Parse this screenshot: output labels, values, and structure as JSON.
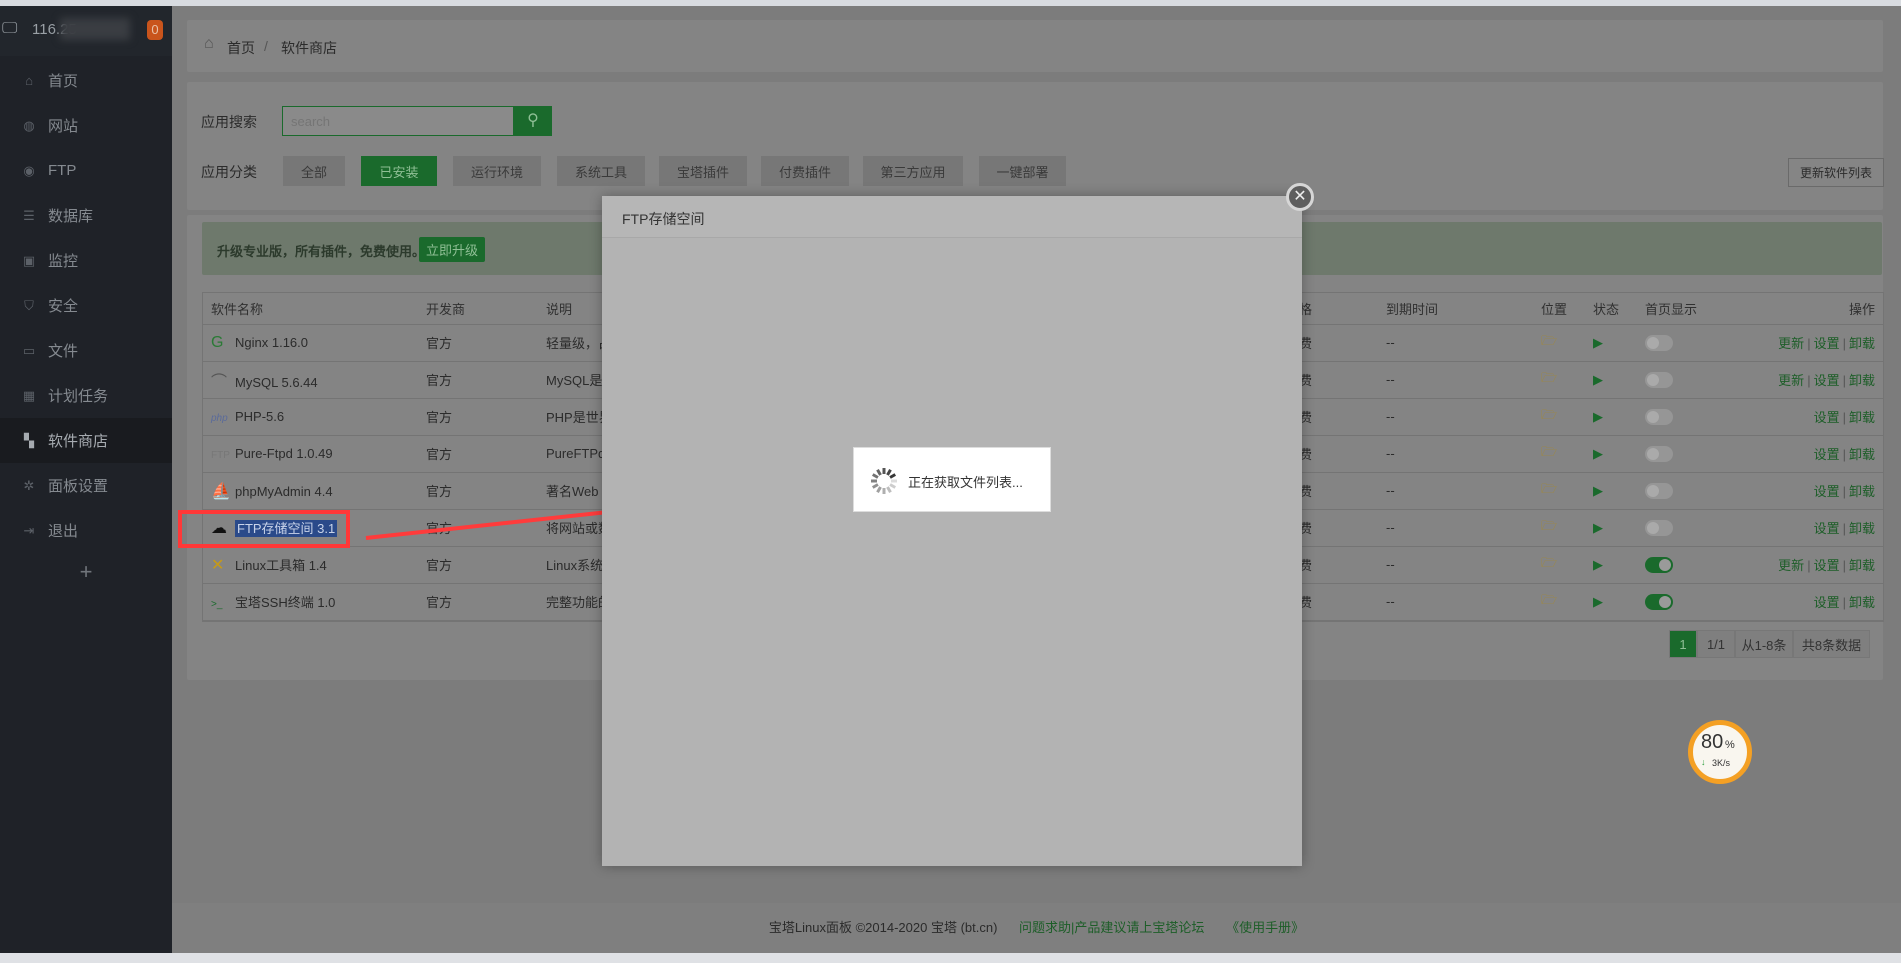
{
  "sidebar": {
    "server_ip": "116.25",
    "badge": "0",
    "items": [
      {
        "label": "首页",
        "icon": "home-icon"
      },
      {
        "label": "网站",
        "icon": "globe-icon"
      },
      {
        "label": "FTP",
        "icon": "ftp-icon"
      },
      {
        "label": "数据库",
        "icon": "database-icon"
      },
      {
        "label": "监控",
        "icon": "monitor-icon"
      },
      {
        "label": "安全",
        "icon": "shield-icon"
      },
      {
        "label": "文件",
        "icon": "folder-icon"
      },
      {
        "label": "计划任务",
        "icon": "calendar-icon"
      },
      {
        "label": "软件商店",
        "icon": "grid-icon",
        "active": true
      },
      {
        "label": "面板设置",
        "icon": "gear-icon"
      },
      {
        "label": "退出",
        "icon": "logout-icon"
      }
    ],
    "add_label": "+"
  },
  "breadcrumb": {
    "home": "首页",
    "sep": "/",
    "current": "软件商店"
  },
  "search": {
    "label": "应用搜索",
    "placeholder": "search"
  },
  "categories": {
    "label": "应用分类",
    "items": [
      "全部",
      "已安装",
      "运行环境",
      "系统工具",
      "宝塔插件",
      "付费插件",
      "第三方应用",
      "一键部署"
    ],
    "active": "已安装"
  },
  "update_list_button": "更新软件列表",
  "banner": {
    "text": "升级专业版，所有插件，免费使用。",
    "button": "立即升级"
  },
  "table": {
    "headers": [
      "软件名称",
      "开发商",
      "说明",
      "价格",
      "到期时间",
      "位置",
      "状态",
      "首页显示",
      "操作"
    ],
    "rows": [
      {
        "name": "Nginx 1.16.0",
        "dev": "官方",
        "desc": "轻量级，占",
        "price": "免费",
        "expire": "--",
        "home": false,
        "ops": [
          "更新",
          "设置",
          "卸载"
        ]
      },
      {
        "name": "MySQL 5.6.44",
        "dev": "官方",
        "desc": "MySQL是一",
        "price": "免费",
        "expire": "--",
        "home": false,
        "ops": [
          "更新",
          "设置",
          "卸载"
        ]
      },
      {
        "name": "PHP-5.6",
        "dev": "官方",
        "desc": "PHP是世界",
        "price": "免费",
        "expire": "--",
        "home": false,
        "ops": [
          "设置",
          "卸载"
        ]
      },
      {
        "name": "Pure-Ftpd 1.0.49",
        "dev": "官方",
        "desc": "PureFTPd",
        "price": "免费",
        "expire": "--",
        "home": false,
        "ops": [
          "设置",
          "卸载"
        ]
      },
      {
        "name": "phpMyAdmin 4.4",
        "dev": "官方",
        "desc": "著名Web",
        "price": "免费",
        "expire": "--",
        "home": false,
        "ops": [
          "设置",
          "卸载"
        ]
      },
      {
        "name": "FTP存储空间 3.1",
        "dev": "官方",
        "desc": "将网站或数",
        "price": "免费",
        "expire": "--",
        "home": false,
        "ops": [
          "设置",
          "卸载"
        ],
        "selected": true
      },
      {
        "name": "Linux工具箱 1.4",
        "dev": "官方",
        "desc": "Linux系统",
        "price": "免费",
        "expire": "--",
        "home": true,
        "ops": [
          "更新",
          "设置",
          "卸载"
        ]
      },
      {
        "name": "宝塔SSH终端 1.0",
        "dev": "官方",
        "desc": "完整功能的",
        "price": "免费",
        "expire": "--",
        "home": true,
        "ops": [
          "设置",
          "卸载"
        ]
      }
    ]
  },
  "pagination": {
    "current": "1",
    "pages": "1/1",
    "range": "从1-8条",
    "total": "共8条数据"
  },
  "modal": {
    "title": "FTP存储空间",
    "loading_text": "正在获取文件列表..."
  },
  "speed_widget": {
    "percent": "80",
    "unit": "%",
    "speed": "3K/s"
  },
  "footer": {
    "copyright": "宝塔Linux面板 ©2014-2020 宝塔 (bt.cn)",
    "forum_link": "问题求助|产品建议请上宝塔论坛",
    "manual_link": "《使用手册》"
  },
  "colors": {
    "accent": "#20a53a",
    "annotation": "#ff3333"
  }
}
